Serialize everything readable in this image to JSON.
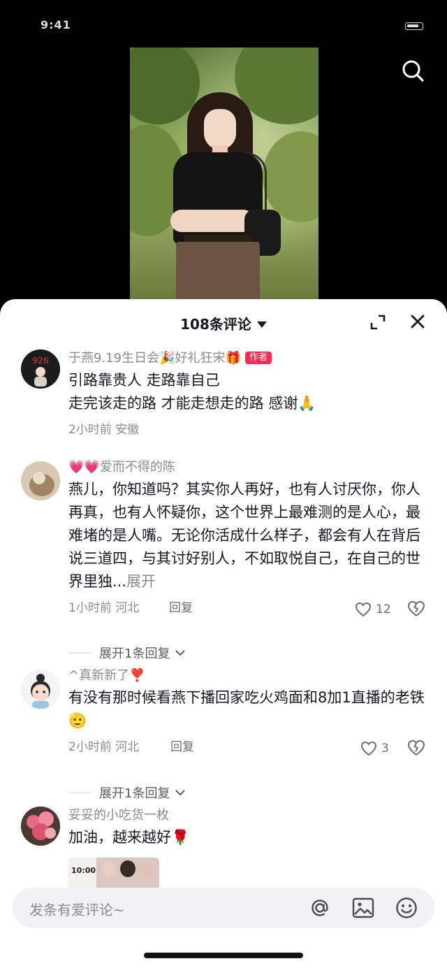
{
  "status_bar": {
    "time": "9:41"
  },
  "sheet": {
    "title": "108条评论"
  },
  "comments": [
    {
      "username": "于燕9.19生日会🎉好礼狂宋🎁",
      "badge": "作者",
      "lines": [
        "引路靠贵人 走路靠自己",
        "走完该走的路 才能走想走的路 感谢🙏"
      ],
      "meta": "2小时前 安徽"
    },
    {
      "username": "💗💗爱而不得的陈",
      "text": "燕儿，你知道吗？其实你人再好，也有人讨厌你，你人再真，也有人怀疑你，这个世界上最难测的是人心，最难堵的是人嘴。无论你活成什么样子，都会有人在背后说三道四，与其讨好别人，不如取悦自己，在自己的世界里独...",
      "more": "展开",
      "meta": "1小时前 河北",
      "reply": "回复",
      "likes": "12",
      "expand": "展开1条回复"
    },
    {
      "username": "^真新新了❣️",
      "text": "有没有那时候看燕下播回家吃火鸡面和8加1直播的老铁🫡",
      "meta": "2小时前 河北",
      "reply": "回复",
      "likes": "3",
      "expand": "展开1条回复"
    },
    {
      "username": "妥妥的小吃货一枚",
      "text": "加油，越来越好🌹",
      "thumb_time": "10:00"
    }
  ],
  "input": {
    "placeholder": "发条有爱评论~"
  },
  "icons": [
    "search-icon",
    "expand-icon",
    "close-icon",
    "heart-icon",
    "dislike-icon",
    "at-icon",
    "image-icon",
    "emoji-icon"
  ]
}
